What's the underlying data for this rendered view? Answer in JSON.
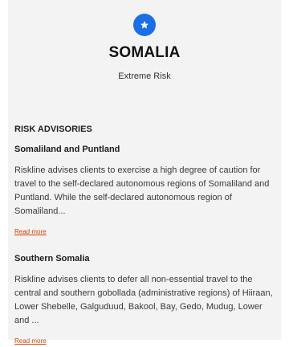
{
  "header": {
    "icon": "star-icon",
    "accent_color": "#1a6fe6",
    "country": "SOMALIA",
    "risk_level": "Extreme Risk"
  },
  "advisories": {
    "heading": "RISK ADVISORIES",
    "items": [
      {
        "title": "Somaliland and Puntland",
        "body": "Riskline advises clients to exercise a high degree of caution for travel to the self-declared autonomous regions of Somaliland and Puntland. While the self-declared autonomous region of Somaliland...",
        "link": "Read more"
      },
      {
        "title": "Southern Somalia",
        "body": "Riskline advises clients to defer all non-essential travel to the central and southern gobollada (administrative regions) of Hiiraan, Lower Shebelle, Galguduud, Bakool, Bay, Gedo, Mudug, Lower and ...",
        "link": "Read more"
      }
    ]
  },
  "colors": {
    "link": "#cc4400",
    "panel_background": "#f3f3f3"
  }
}
